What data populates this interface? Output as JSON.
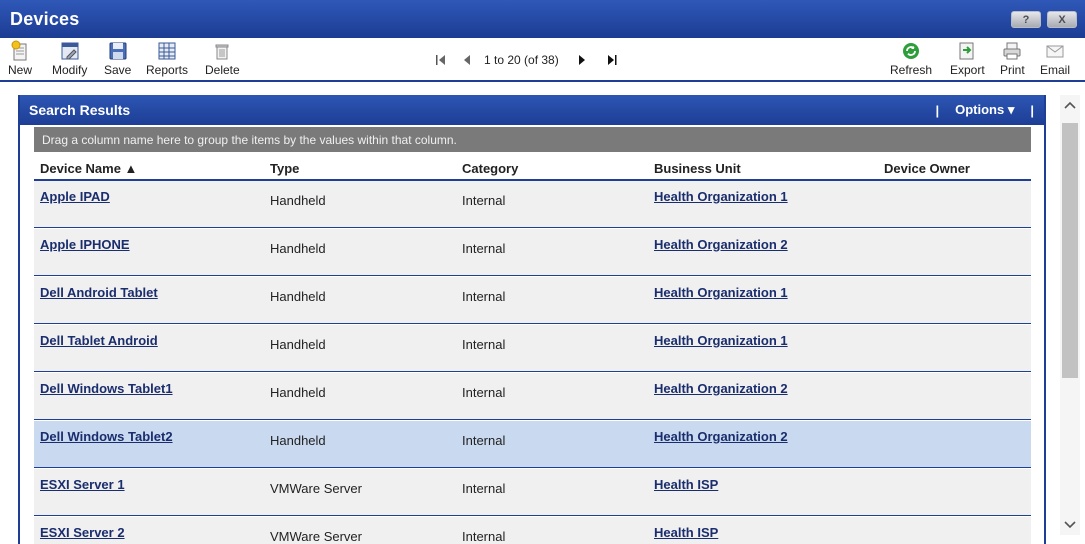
{
  "window": {
    "title": "Devices",
    "help_label": "?",
    "close_label": "X"
  },
  "toolbar": {
    "new": "New",
    "modify": "Modify",
    "save": "Save",
    "reports": "Reports",
    "delete": "Delete",
    "refresh": "Refresh",
    "export": "Export",
    "print": "Print",
    "email": "Email"
  },
  "pager": {
    "text": "1 to 20 (of 38)"
  },
  "panel": {
    "title": "Search Results",
    "options_label": "Options ▾",
    "separator": "|",
    "group_hint": "Drag a column name here to group the items by the values within that column."
  },
  "columns": {
    "device_name": "Device Name ▲",
    "type": "Type",
    "category": "Category",
    "business_unit": "Business Unit",
    "device_owner": "Device Owner"
  },
  "rows": [
    {
      "name": "Apple IPAD",
      "type": "Handheld",
      "category": "Internal",
      "business_unit": "Health Organization 1",
      "owner": ""
    },
    {
      "name": "Apple IPHONE",
      "type": "Handheld",
      "category": "Internal",
      "business_unit": "Health Organization 2",
      "owner": ""
    },
    {
      "name": "Dell Android Tablet",
      "type": "Handheld",
      "category": "Internal",
      "business_unit": "Health Organization 1",
      "owner": ""
    },
    {
      "name": "Dell Tablet Android",
      "type": "Handheld",
      "category": "Internal",
      "business_unit": "Health Organization 1",
      "owner": ""
    },
    {
      "name": "Dell Windows Tablet1",
      "type": "Handheld",
      "category": "Internal",
      "business_unit": "Health Organization 2",
      "owner": ""
    },
    {
      "name": "Dell Windows Tablet2",
      "type": "Handheld",
      "category": "Internal",
      "business_unit": "Health Organization 2",
      "owner": "",
      "selected": true
    },
    {
      "name": "ESXI Server 1",
      "type": "VMWare Server",
      "category": "Internal",
      "business_unit": "Health ISP",
      "owner": ""
    },
    {
      "name": "ESXI Server 2",
      "type": "VMWare Server",
      "category": "Internal",
      "business_unit": "Health ISP",
      "owner": ""
    }
  ],
  "colors": {
    "brand_blue": "#1f3f96",
    "selected_row": "#c9daf0",
    "row_bg": "#f0f0f0",
    "link": "#1a2d6d",
    "refresh_green": "#2e9e3a"
  }
}
